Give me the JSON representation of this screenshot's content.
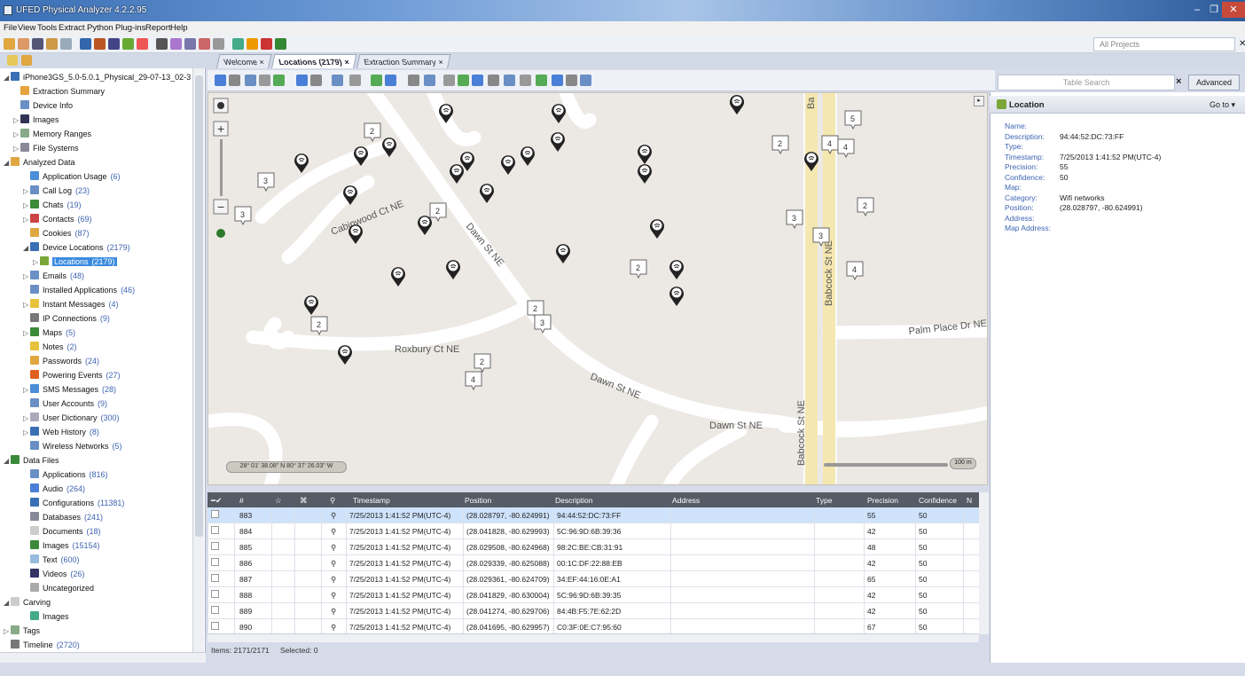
{
  "window": {
    "title": "UFED Physical Analyzer 4.2.2.95"
  },
  "menu": [
    "File",
    "View",
    "Tools",
    "Extract",
    "Python",
    "Plug-ins",
    "Report",
    "Help"
  ],
  "projects_dropdown": "All Projects",
  "tabs": [
    {
      "label": "Welcome",
      "close": "×"
    },
    {
      "label": "Locations (2179)",
      "close": "×"
    },
    {
      "label": "Extraction Summary",
      "close": "×"
    }
  ],
  "tree": {
    "root": "iPhone3GS_5.0-5.0.1_Physical_29-07-13_02-3",
    "items": [
      {
        "label": "Extraction Summary",
        "count": ""
      },
      {
        "label": "Device Info",
        "count": ""
      },
      {
        "label": "Images",
        "count": ""
      },
      {
        "label": "Memory Ranges",
        "count": ""
      },
      {
        "label": "File Systems",
        "count": ""
      },
      {
        "label": "Analyzed Data",
        "count": ""
      },
      {
        "label": "Application Usage",
        "count": "(6)"
      },
      {
        "label": "Call Log",
        "count": "(23)"
      },
      {
        "label": "Chats",
        "count": "(19)"
      },
      {
        "label": "Contacts",
        "count": "(69)"
      },
      {
        "label": "Cookies",
        "count": "(87)"
      },
      {
        "label": "Device Locations",
        "count": "(2179)"
      },
      {
        "label": "Locations",
        "count": "(2179)"
      },
      {
        "label": "Emails",
        "count": "(48)"
      },
      {
        "label": "Installed Applications",
        "count": "(46)"
      },
      {
        "label": "Instant Messages",
        "count": "(4)"
      },
      {
        "label": "IP Connections",
        "count": "(9)"
      },
      {
        "label": "Maps",
        "count": "(5)"
      },
      {
        "label": "Notes",
        "count": "(2)"
      },
      {
        "label": "Passwords",
        "count": "(24)"
      },
      {
        "label": "Powering Events",
        "count": "(27)"
      },
      {
        "label": "SMS Messages",
        "count": "(28)"
      },
      {
        "label": "User Accounts",
        "count": "(9)"
      },
      {
        "label": "User Dictionary",
        "count": "(300)"
      },
      {
        "label": "Web History",
        "count": "(8)"
      },
      {
        "label": "Wireless Networks",
        "count": "(5)"
      },
      {
        "label": "Data Files",
        "count": ""
      },
      {
        "label": "Applications",
        "count": "(816)"
      },
      {
        "label": "Audio",
        "count": "(264)"
      },
      {
        "label": "Configurations",
        "count": "(11381)"
      },
      {
        "label": "Databases",
        "count": "(241)"
      },
      {
        "label": "Documents",
        "count": "(18)"
      },
      {
        "label": "Images",
        "count": "(15154)"
      },
      {
        "label": "Text",
        "count": "(600)"
      },
      {
        "label": "Videos",
        "count": "(26)"
      },
      {
        "label": "Uncategorized",
        "count": ""
      },
      {
        "label": "Carving",
        "count": ""
      },
      {
        "label": "Images",
        "count": ""
      },
      {
        "label": "Tags",
        "count": ""
      },
      {
        "label": "Timeline",
        "count": "(2720)"
      }
    ]
  },
  "table_search": {
    "placeholder": "Table Search",
    "advanced": "Advanced",
    "clear": "×"
  },
  "map": {
    "streets": [
      "Dawn St NE",
      "Dawn St NE",
      "Dawn St NE",
      "Roxbury Ct NE",
      "Babcock St NE",
      "Babcock St NE",
      "Palm Place Dr NE",
      "Cabinwood Ct NE",
      "Ba"
    ],
    "clusters": [
      "2",
      "3",
      "3",
      "2",
      "2",
      "3",
      "2",
      "2",
      "3",
      "2",
      "3",
      "4",
      "2",
      "2",
      "4",
      "4",
      "4",
      "5"
    ],
    "coord_readout": "28° 01' 38.08\" N 80° 37' 26.03\" W",
    "scale": "100 m"
  },
  "location": {
    "header": "Location",
    "goto": "Go to",
    "fields": [
      {
        "k": "Name:",
        "v": ""
      },
      {
        "k": "Description:",
        "v": "94:44:52:DC:73:FF"
      },
      {
        "k": "Type:",
        "v": ""
      },
      {
        "k": "Timestamp:",
        "v": "7/25/2013 1:41:52 PM(UTC-4)"
      },
      {
        "k": "Precision:",
        "v": "55"
      },
      {
        "k": "Confidence:",
        "v": "50"
      },
      {
        "k": "Map:",
        "v": ""
      },
      {
        "k": "Category:",
        "v": "Wifi networks"
      },
      {
        "k": "Position:",
        "v": "(28.028797, -80.624991)"
      },
      {
        "k": "Address:",
        "v": ""
      },
      {
        "k": "Map Address:",
        "v": ""
      }
    ]
  },
  "grid": {
    "columns": [
      "#",
      "Timestamp",
      "Position",
      "Description",
      "Address",
      "Type",
      "Precision",
      "Confidence",
      "N"
    ],
    "rows": [
      {
        "n": "883",
        "ts": "7/25/2013 1:41:52 PM(UTC-4)",
        "pos": "(28.028797, -80.624991)",
        "desc": "94:44:52:DC:73:FF",
        "prec": "55",
        "conf": "50"
      },
      {
        "n": "884",
        "ts": "7/25/2013 1:41:52 PM(UTC-4)",
        "pos": "(28.041828, -80.629993)",
        "desc": "5C:96:9D:6B:39:36",
        "prec": "42",
        "conf": "50"
      },
      {
        "n": "885",
        "ts": "7/25/2013 1:41:52 PM(UTC-4)",
        "pos": "(28.029508, -80.624968)",
        "desc": "98:2C:BE:CB:31:91",
        "prec": "48",
        "conf": "50"
      },
      {
        "n": "886",
        "ts": "7/25/2013 1:41:52 PM(UTC-4)",
        "pos": "(28.029339, -80.625088)",
        "desc": "00:1C:DF:22:88:EB",
        "prec": "42",
        "conf": "50"
      },
      {
        "n": "887",
        "ts": "7/25/2013 1:41:52 PM(UTC-4)",
        "pos": "(28.029361, -80.624709)",
        "desc": "34:EF:44:16:0E:A1",
        "prec": "65",
        "conf": "50"
      },
      {
        "n": "888",
        "ts": "7/25/2013 1:41:52 PM(UTC-4)",
        "pos": "(28.041829, -80.630004)",
        "desc": "5C:96:9D:6B:39:35",
        "prec": "42",
        "conf": "50"
      },
      {
        "n": "889",
        "ts": "7/25/2013 1:41:52 PM(UTC-4)",
        "pos": "(28.041274, -80.629706)",
        "desc": "84:4B:F5:7E:62:2D",
        "prec": "42",
        "conf": "50"
      },
      {
        "n": "890",
        "ts": "7/25/2013 1:41:52 PM(UTC-4)",
        "pos": "(28.041695, -80.629957)",
        "desc": "C0:3F:0E:C7:95:60",
        "prec": "67",
        "conf": "50"
      }
    ]
  },
  "status": {
    "items": "Items: 2171/2171",
    "selected": "Selected: 0"
  }
}
